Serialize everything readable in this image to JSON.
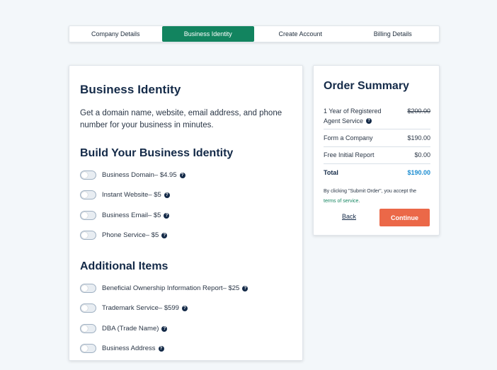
{
  "steps": {
    "items": [
      {
        "label": "Company Details"
      },
      {
        "label": "Business Identity"
      },
      {
        "label": "Create Account"
      },
      {
        "label": "Billing Details"
      }
    ],
    "active_index": 1
  },
  "main": {
    "title": "Business Identity",
    "intro": "Get a domain name, website, email address, and phone number for your business in minutes.",
    "section1_title": "Build Your Business Identity",
    "section1_options": [
      {
        "label": "Business Domain",
        "price": " – $4.95",
        "checked": false
      },
      {
        "label": "Instant Website",
        "price": " – $5",
        "checked": false
      },
      {
        "label": "Business Email",
        "price": " – $5",
        "checked": false
      },
      {
        "label": "Phone Service",
        "price": " – $5",
        "checked": false
      }
    ],
    "section2_title": "Additional Items",
    "section2_options": [
      {
        "label": "Beneficial Ownership Information Report",
        "price": " – $25",
        "checked": false
      },
      {
        "label": "Trademark Service",
        "price": " – $599",
        "checked": false
      },
      {
        "label": "DBA (Trade Name)",
        "price": "",
        "checked": false
      },
      {
        "label": "Business Address",
        "price": "",
        "checked": false
      }
    ],
    "help_glyph": "?"
  },
  "summary": {
    "title": "Order Summary",
    "rows": [
      {
        "label_line1": "1 Year of Registered",
        "label_line2": "Agent Service",
        "value": "$200.00",
        "strikethrough": true
      },
      {
        "label": "Form a Company",
        "value": "$190.00"
      },
      {
        "label": "Free Initial Report",
        "value": "$0.00"
      }
    ],
    "total_label": "Total",
    "total_value": "$190.00",
    "terms_text": "By clicking \"Submit Order\", you accept the",
    "terms_link": "terms of service",
    "terms_end": ".",
    "back_label": "Back",
    "continue_label": "Continue"
  },
  "colors": {
    "brand_green": "#12845f",
    "accent_orange": "#eb6848",
    "total_blue": "#1a8cd1",
    "navy": "#142a48"
  }
}
